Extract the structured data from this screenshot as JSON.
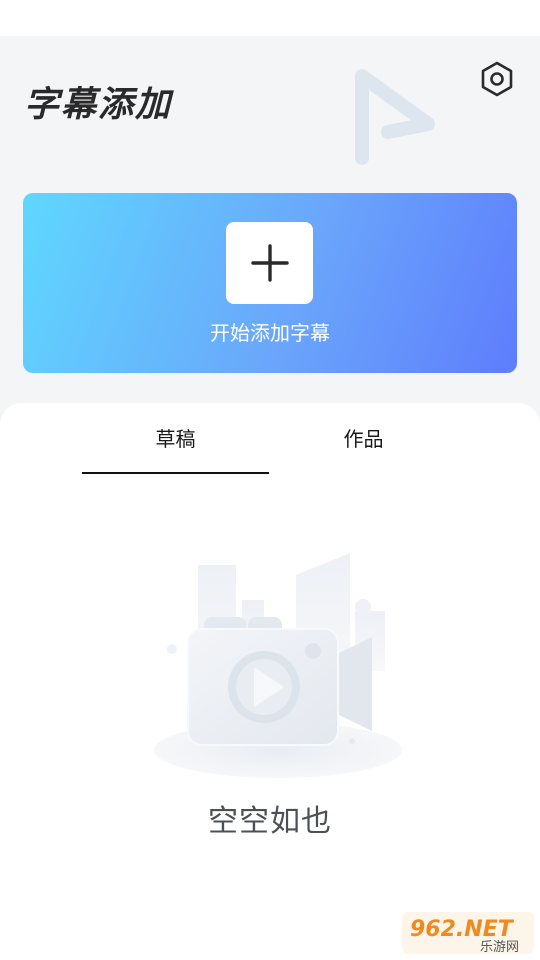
{
  "header": {
    "title": "字幕添加"
  },
  "add_card": {
    "label": "开始添加字幕"
  },
  "tabs": [
    {
      "label": "草稿",
      "active": true
    },
    {
      "label": "作品",
      "active": false
    }
  ],
  "empty_state": {
    "text": "空空如也"
  },
  "icons": {
    "settings": "hexagon-gear-icon",
    "plus": "plus-icon",
    "empty": "camera-illustration"
  },
  "colors": {
    "accent_start": "#5fd7fe",
    "accent_end": "#5e7dfc",
    "background": "#f4f5f7"
  },
  "watermark": {
    "brand": "962.NET",
    "subtitle": "乐游网"
  }
}
